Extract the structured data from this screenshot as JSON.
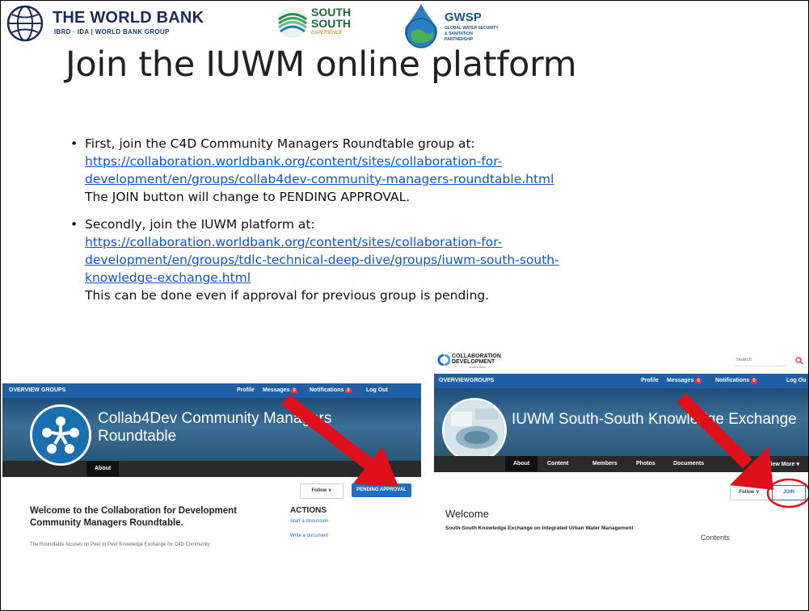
{
  "header": {
    "worldbank": {
      "title": "THE WORLD BANK",
      "subtitle": "IBRD · IDA | WORLD BANK GROUP"
    },
    "southsouth": {
      "line1": "SOUTH",
      "line2": "SOUTH",
      "line3": "EXPERIENCE"
    },
    "gwsp": {
      "title": "GWSP",
      "subtitle": "GLOBAL WATER SECURITY & SANITATION PARTNERSHIP"
    }
  },
  "title": "Join the IUWM online platform",
  "bullets": [
    {
      "intro": "First, join the C4D Community Managers Roundtable group at:",
      "link_lines": [
        "https://collaboration.worldbank.org/content/sites/collaboration-for-",
        "development/en/groups/collab4dev-community-managers-roundtable.html"
      ],
      "note": "The JOIN button will change to PENDING APPROVAL."
    },
    {
      "intro": "Secondly, join the IUWM platform at:",
      "link_lines": [
        "https://collaboration.worldbank.org/content/sites/collaboration-for-",
        "development/en/groups/tdlc-technical-deep-dive/groups/iuwm-south-south-",
        "knowledge-exchange.html"
      ],
      "note": "This can be done even if approval for previous group is pending."
    }
  ],
  "shot1": {
    "nav_left": [
      "OVERVIEW",
      "GROUPS"
    ],
    "nav_right": [
      "Profile",
      "Messages",
      "Notifications",
      "Log Out"
    ],
    "badge_messages": "0",
    "badge_notifications": "0",
    "banner_line1": "Collab4Dev Community Managers",
    "banner_line2": "Roundtable",
    "tab_about": "About",
    "follow_label": "Follow ∨",
    "pending_label": "PENDING APPROVAL",
    "welcome_line1": "Welcome to the Collaboration for Development",
    "welcome_line2": "Community Managers Roundtable.",
    "actions_title": "ACTIONS",
    "actions": [
      "Start a discussion",
      "Write a document"
    ],
    "desc": "The Roundtable focuses on Peer to Peer Knowledge Exchange for C4D Community"
  },
  "shot2": {
    "logo_line1": "COLLABORATION",
    "logo_line2": "DEVELOPMENT",
    "logo_line3": "WORLD BANK",
    "search_placeholder": "Search",
    "nav_left": [
      "OVERVIEW",
      "GROUPS"
    ],
    "nav_right": [
      "Profile",
      "Messages",
      "Notifications",
      "Log Ou"
    ],
    "badge_messages": "0",
    "badge_notifications": "0",
    "banner_title": "IUWM South-South Knowledge Exchange",
    "tabs": [
      "About",
      "Content",
      "Members",
      "Photos",
      "Documents",
      "View More ▾"
    ],
    "follow_label": "Follow ∨",
    "join_label": "JOIN",
    "welcome": "Welcome",
    "desc": "South-South Knowledge Exchange on Integrated Urban Water Management",
    "contents_label": "Contents"
  }
}
